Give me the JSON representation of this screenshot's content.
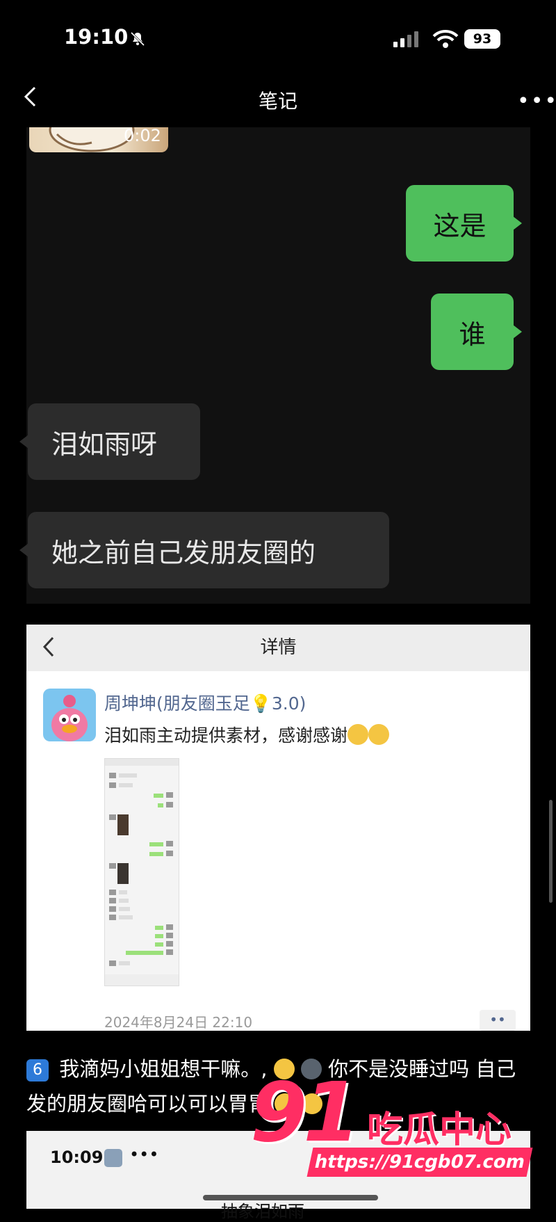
{
  "status_bar": {
    "time": "19:10",
    "battery": "93"
  },
  "nav": {
    "title": "笔记"
  },
  "chat": {
    "video_duration": "0:02",
    "messages": [
      {
        "side": "out",
        "text": "这是"
      },
      {
        "side": "out",
        "text": "谁"
      },
      {
        "side": "in",
        "text": "泪如雨呀"
      },
      {
        "side": "in",
        "text": "她之前自己发朋友圈的"
      }
    ]
  },
  "detail": {
    "title": "详情",
    "poster_name": "周坤坤(朋友圈玉足💡3.0)",
    "post_text": "泪如雨主动提供素材，感谢感谢",
    "date": "2024年8月24日 22:10",
    "comment_button": "••"
  },
  "caption": {
    "badge": "6",
    "part1": "我滴妈小姐姐想干嘛。,",
    "part2": "你不是没睡过吗 自己发的朋友圈哈可以可以",
    "part3": "胃胃"
  },
  "bottom": {
    "time": "10:09",
    "dots": "•••",
    "title": "抽象泪如雨"
  },
  "watermark": {
    "number": "91",
    "name": "吃瓜中心",
    "url": "https://91cgb07.com"
  },
  "colors": {
    "bubble_out": "#4fbf5c",
    "bubble_in": "#2c2c2c",
    "brand_pink": "#ff2e63",
    "link_blue": "#52678f"
  }
}
